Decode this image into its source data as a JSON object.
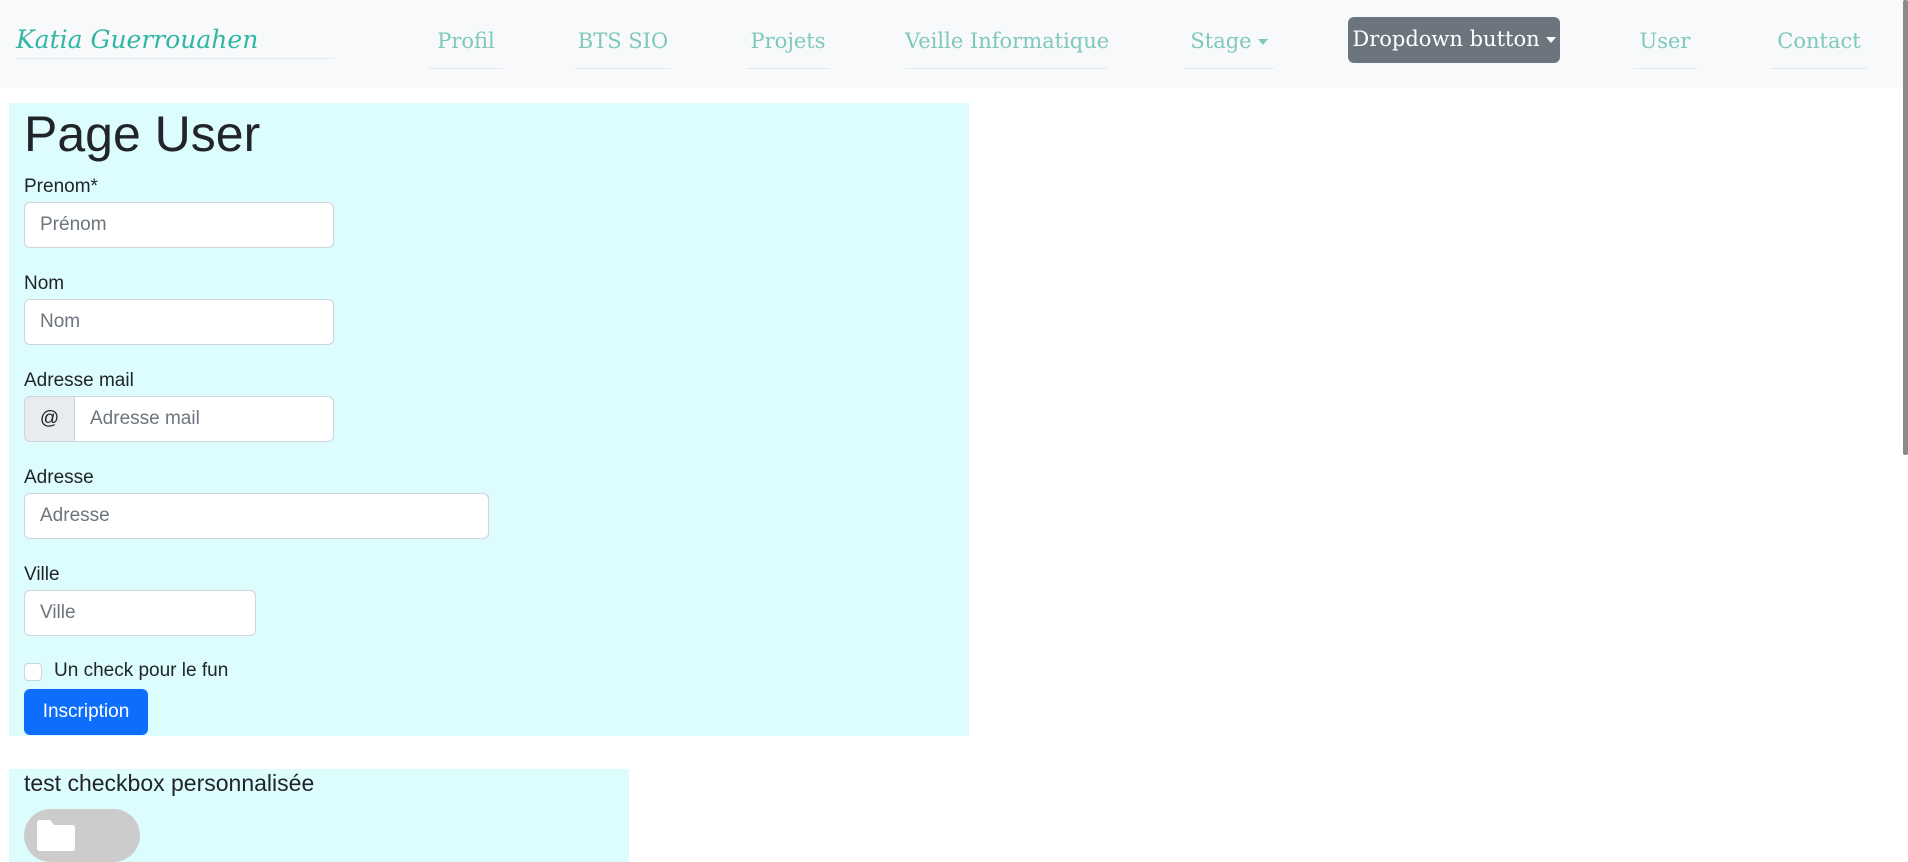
{
  "navbar": {
    "brand": "Katia Guerrouahen",
    "links": [
      "Profil",
      "BTS SIO",
      "Projets",
      "Veille Informatique",
      "Stage",
      "User",
      "Contact"
    ],
    "dropdown_button": "Dropdown button"
  },
  "page": {
    "title": "Page User"
  },
  "form": {
    "prenom": {
      "label": "Prenom*",
      "placeholder": "Prénom"
    },
    "nom": {
      "label": "Nom",
      "placeholder": "Nom"
    },
    "email": {
      "label": "Adresse mail",
      "addon": "@",
      "placeholder": "Adresse mail"
    },
    "adresse": {
      "label": "Adresse",
      "placeholder": "Adresse"
    },
    "ville": {
      "label": "Ville",
      "placeholder": "Ville"
    },
    "checkbox_label": "Un check pour le fun",
    "submit_label": "Inscription"
  },
  "custom_checkbox": {
    "title": "test checkbox personnalisée",
    "icon": "folder-icon",
    "checked": false
  },
  "colors": {
    "brand_teal": "#31b6a4",
    "nav_link": "#7fc8bd",
    "panel_bg": "#dcfcfe",
    "primary": "#0d6efd",
    "secondary": "#6c757d"
  }
}
